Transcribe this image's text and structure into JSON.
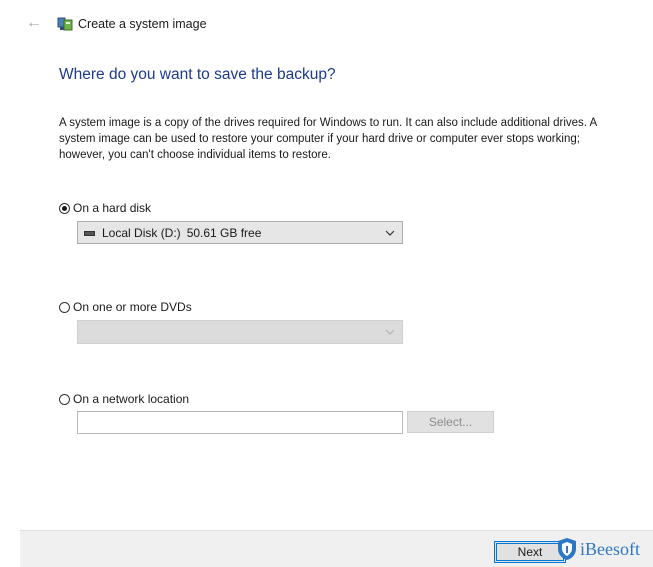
{
  "header": {
    "back_icon": "back-arrow-icon",
    "app_icon": "system-image-icon",
    "window_title": "Create a system image"
  },
  "main": {
    "heading": "Where do you want to save the backup?",
    "description": "A system image is a copy of the drives required for Windows to run. It can also include additional drives. A system image can be used to restore your computer if your hard drive or computer ever stops working; however, you can't choose individual items to restore."
  },
  "options": {
    "hard_disk": {
      "label": "On a hard disk",
      "selected": true,
      "drive_name": "Local Disk (D:)",
      "drive_free": "50.61 GB free"
    },
    "dvd": {
      "label": "On one or more DVDs",
      "selected": false,
      "value": ""
    },
    "network": {
      "label": "On a network location",
      "selected": false,
      "value": "",
      "select_button": "Select..."
    }
  },
  "footer": {
    "next_button": "Next"
  },
  "watermark": {
    "text": "iBeesoft"
  },
  "colors": {
    "heading": "#1d3a8c",
    "accent": "#0078d7",
    "watermark": "#2d78c4"
  }
}
